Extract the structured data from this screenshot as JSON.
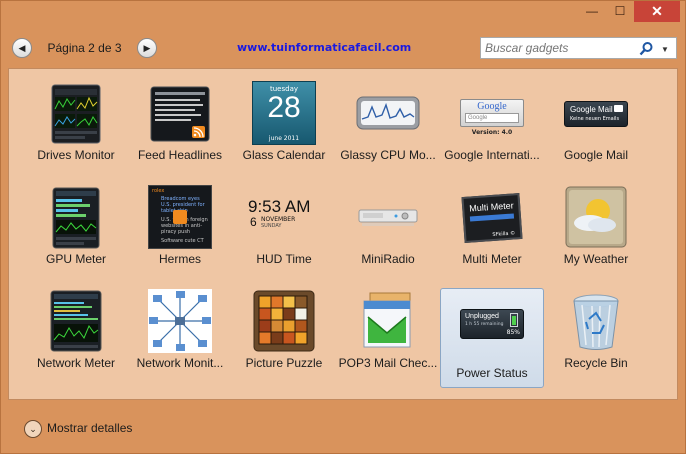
{
  "window": {
    "close_glyph": "✕",
    "maximize_glyph": "☐",
    "minimize_glyph": "—"
  },
  "pager": {
    "label": "Página 2 de 3",
    "prev_glyph": "◀",
    "next_glyph": "▶"
  },
  "site_link": "www.tuinformaticafacil.com",
  "search": {
    "placeholder": "Buscar gadgets",
    "dropdown_glyph": "▼"
  },
  "gadgets": [
    {
      "label": "Drives Monitor",
      "icon": "drives-monitor-icon",
      "thumb_text": "Drives Monitor"
    },
    {
      "label": "Feed Headlines",
      "icon": "feed-headlines-icon"
    },
    {
      "label": "Glass Calendar",
      "icon": "glass-calendar-icon",
      "day_name": "tuesday",
      "day": "28",
      "month_year": "june 2011"
    },
    {
      "label": "Glassy CPU Mo...",
      "icon": "glassy-cpu-icon"
    },
    {
      "label": "Google Internati...",
      "icon": "google-international-icon",
      "brand": "Google",
      "field_text": "Google",
      "version": "Version: 4.0"
    },
    {
      "label": "Google Mail",
      "icon": "google-mail-icon",
      "title": "Google Mail",
      "subtitle": "Keine neuen Emails"
    },
    {
      "label": "GPU Meter",
      "icon": "gpu-meter-icon",
      "thumb_text": "GPU Meter"
    },
    {
      "label": "Hermes",
      "icon": "hermes-icon",
      "lines": [
        "rolex",
        "Breadcom eyes U.S. president for tablet chip",
        "U.S. to ban foreign websites in anti-piracy push",
        "Software cute CT"
      ]
    },
    {
      "label": "HUD Time",
      "icon": "hud-time-icon",
      "time": "9:53 AM",
      "day": "6",
      "month": "NOVEMBER",
      "weekday": "SUNDAY"
    },
    {
      "label": "MiniRadio",
      "icon": "miniradio-icon"
    },
    {
      "label": "Multi Meter",
      "icon": "multi-meter-icon",
      "title": "Multi Meter",
      "credit": "SFkilla ©"
    },
    {
      "label": "My Weather",
      "icon": "my-weather-icon"
    },
    {
      "label": "Network Meter",
      "icon": "network-meter-icon",
      "thumb_text": "Network Meter"
    },
    {
      "label": "Network Monit...",
      "icon": "network-monitor-icon"
    },
    {
      "label": "Picture Puzzle",
      "icon": "picture-puzzle-icon"
    },
    {
      "label": "POP3 Mail Chec...",
      "icon": "pop3-mail-icon"
    },
    {
      "label": "Power Status",
      "icon": "power-status-icon",
      "state": "Unplugged",
      "remaining": "1 h 55 remaining",
      "percent": "85%",
      "selected": true
    },
    {
      "label": "Recycle Bin",
      "icon": "recycle-bin-icon"
    }
  ],
  "footer": {
    "label": "Mostrar detalles",
    "glyph": "⌄"
  },
  "colors": {
    "window": "#d9935c",
    "panel": "#efc6a4",
    "selection": "#d6e1ee",
    "link": "#1a1ae0",
    "close": "#c84438"
  }
}
